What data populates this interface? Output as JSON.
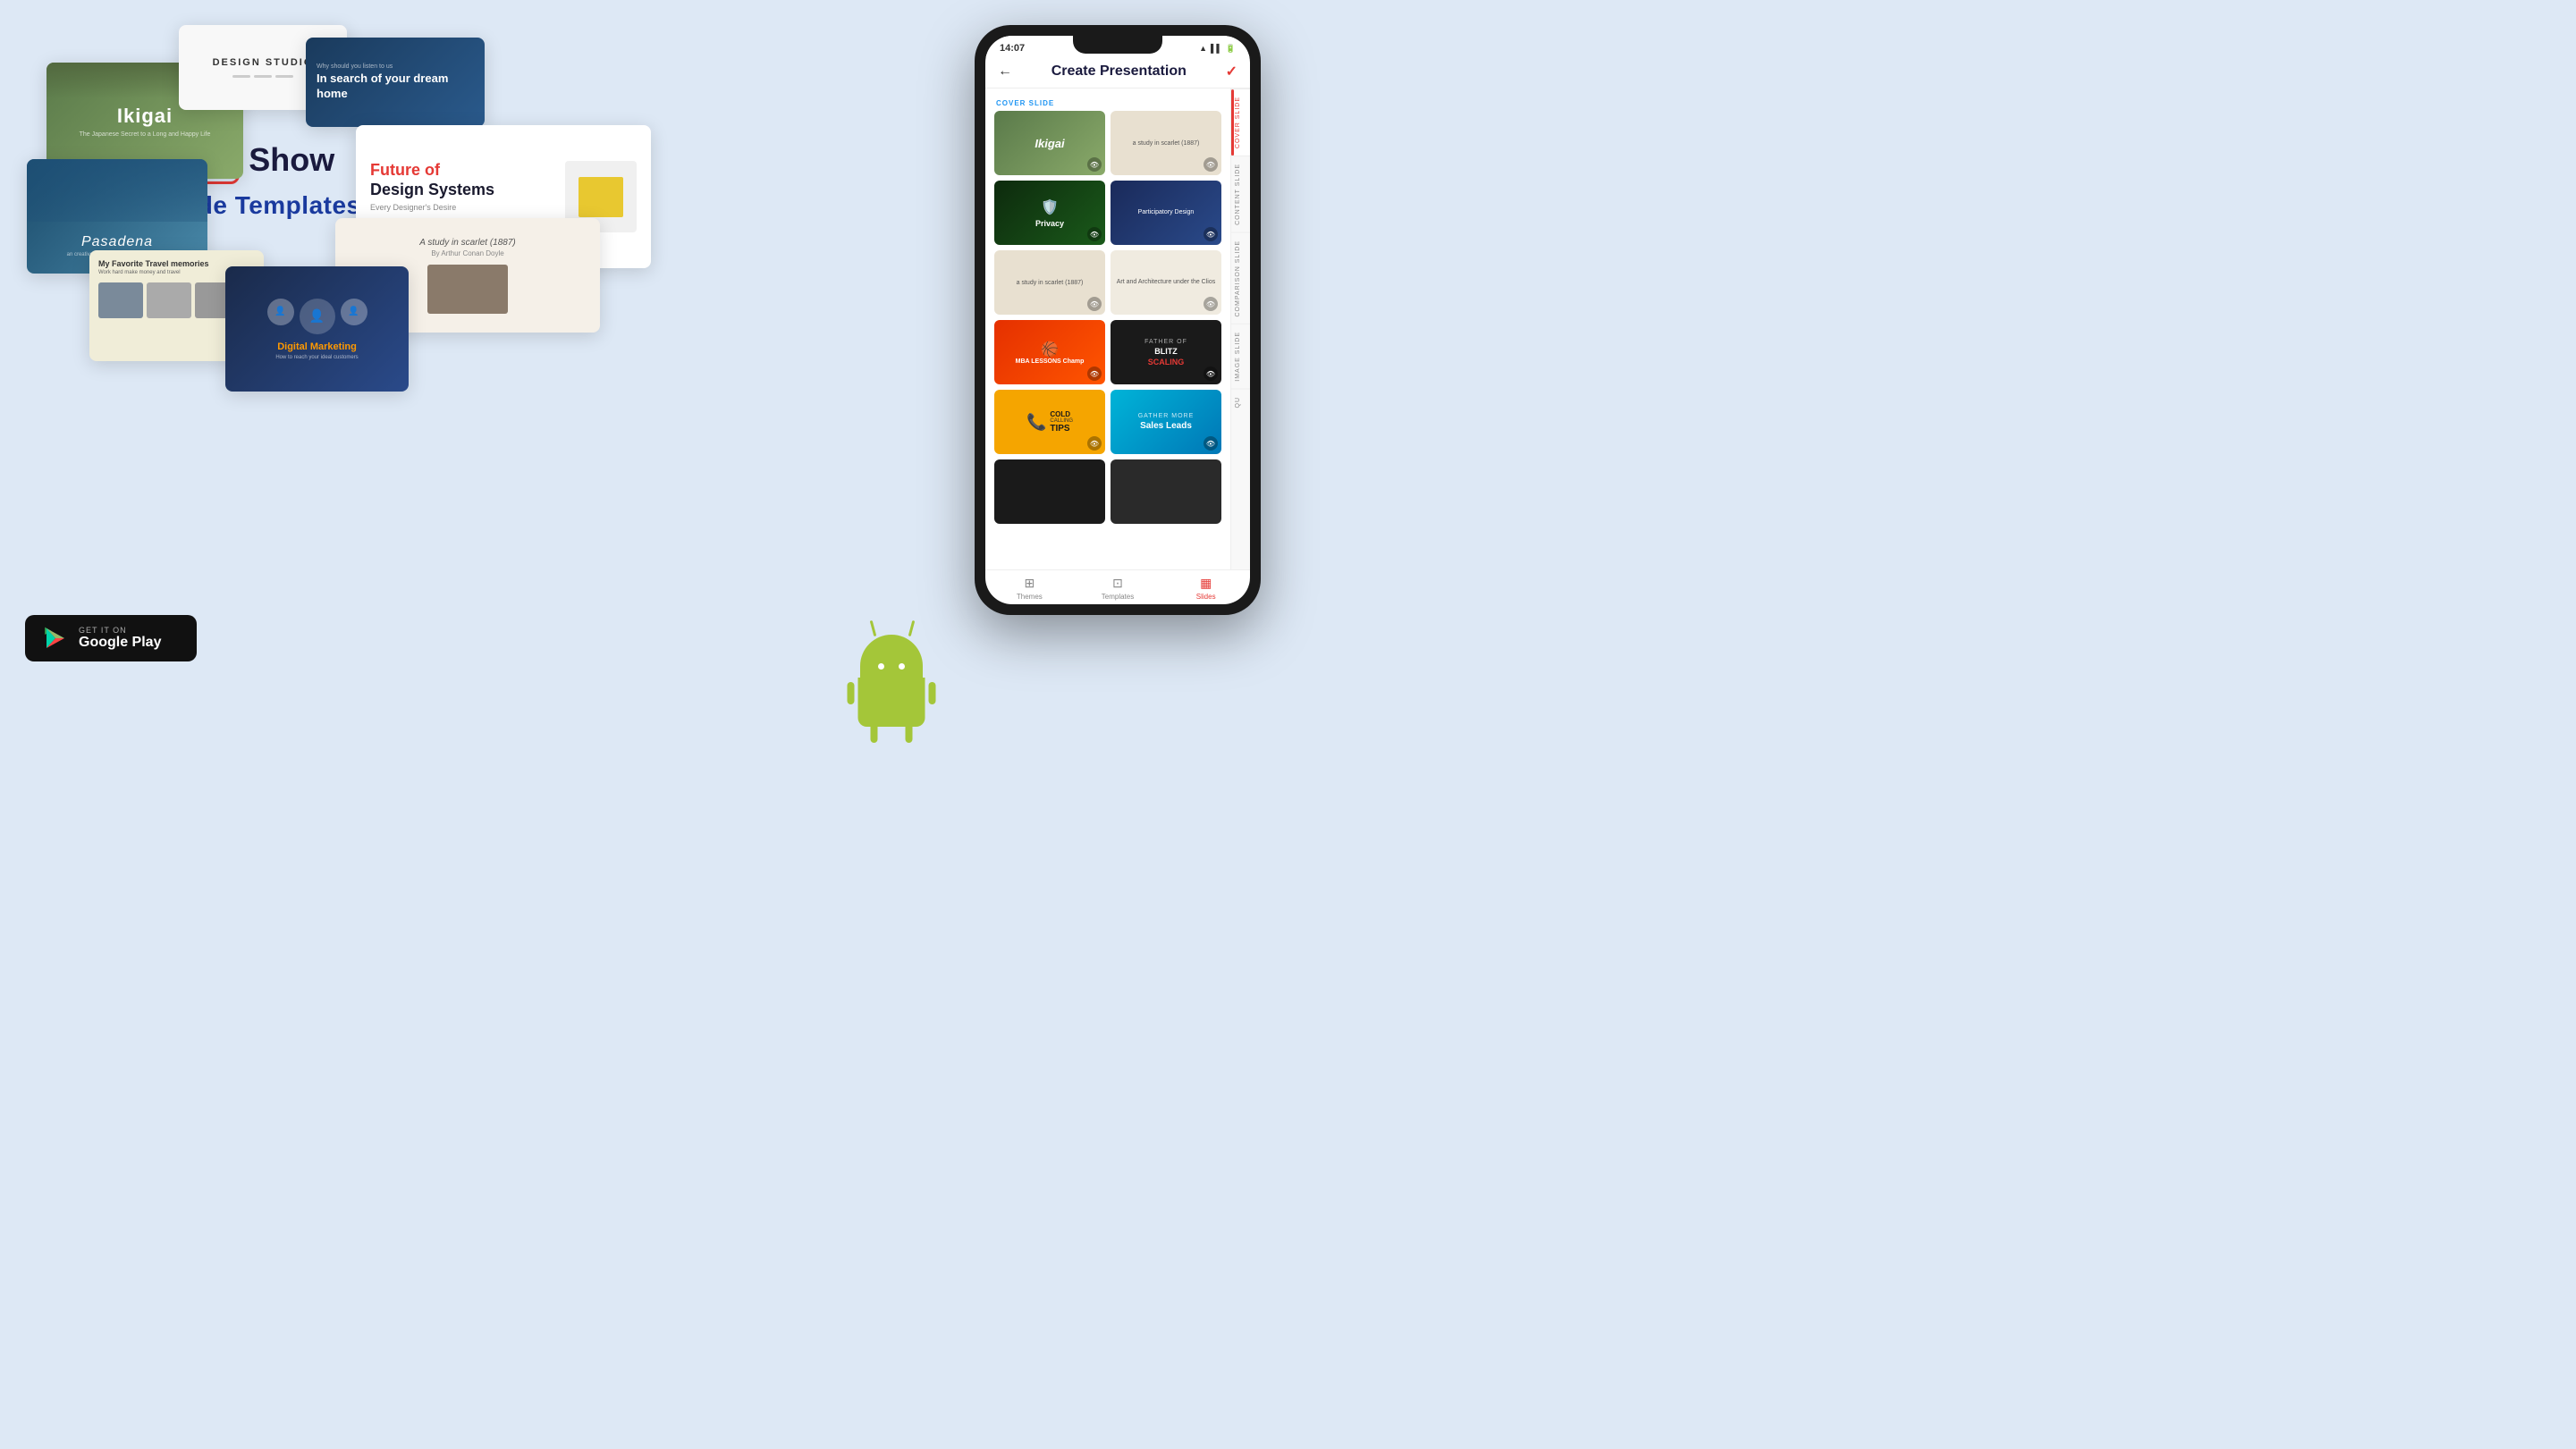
{
  "page": {
    "background_color": "#dde8f5",
    "title": "Show Slide Templates"
  },
  "brand": {
    "name": "Show",
    "subtitle": "Slide Templates",
    "icon_symbol": "▶"
  },
  "thumbnails": [
    {
      "id": "ikigai",
      "title": "Ikigai",
      "subtitle": "The Japanese Secret to a Long and Happy Life",
      "style": "botanical-green"
    },
    {
      "id": "design-studio",
      "title": "DESIGN STUDIO",
      "style": "minimal-white"
    },
    {
      "id": "dream-home",
      "label": "Why should you listen to us",
      "title": "In search of your dream home",
      "style": "dark-blue"
    },
    {
      "id": "pasadena",
      "title": "Pasadena",
      "subtitle": "an creative of places designers and others",
      "style": "mountain-blue"
    },
    {
      "id": "future-design",
      "title": "Future of Design Systems",
      "subtitle": "Every Designer's Desire",
      "style": "white-red"
    },
    {
      "id": "travel",
      "title": "My Favorite Travel memories",
      "subtitle": "Work hard make money and travel",
      "style": "beige"
    },
    {
      "id": "scarlet",
      "title": "A study in scarlet (1887)",
      "subtitle": "By Arthur Conan Doyle",
      "style": "off-white"
    },
    {
      "id": "digital-marketing",
      "title": "Digital Marketing",
      "subtitle": "How to reach your ideal customers",
      "style": "dark-navy"
    }
  ],
  "phone": {
    "time": "14:07",
    "app_title": "Create Presentation",
    "back_icon": "←",
    "check_icon": "✓",
    "section_label": "COVER SLIDE",
    "cover_slide_label": "COVER SLIDE",
    "slides": [
      {
        "id": "s1",
        "style": "card-ikigai",
        "text": "Ikigai"
      },
      {
        "id": "s2",
        "style": "card-study",
        "text": "A study in scarlet"
      },
      {
        "id": "s3",
        "style": "card-privacy",
        "text": "Privacy",
        "icon": "🛡️"
      },
      {
        "id": "s4",
        "style": "card-participatory",
        "text": "Participatory Design"
      },
      {
        "id": "s5",
        "style": "card-arch",
        "text": ""
      },
      {
        "id": "s6",
        "style": "card-arch2",
        "text": "Art and Architecture under the Clios"
      },
      {
        "id": "s7",
        "style": "card-mba",
        "text": "MBA LESSONS Champ"
      },
      {
        "id": "s8",
        "style": "card-blitz",
        "text": "BLITZ SCALING"
      },
      {
        "id": "s9",
        "style": "card-cold",
        "text": "COLD CALLING TIPS"
      },
      {
        "id": "s10",
        "style": "card-sales",
        "text": "Sales Leads"
      },
      {
        "id": "s11",
        "style": "card-dark1",
        "text": ""
      },
      {
        "id": "s12",
        "style": "card-dark2",
        "text": ""
      }
    ],
    "side_tabs": [
      {
        "id": "cover",
        "label": "COVER SLIDE",
        "active": true
      },
      {
        "id": "content",
        "label": "CONTENT SLIDE",
        "active": false
      },
      {
        "id": "comparison",
        "label": "COMPARISON SLIDE",
        "active": false
      },
      {
        "id": "image",
        "label": "IMAGE SLIDE",
        "active": false
      },
      {
        "id": "quote",
        "label": "QU",
        "active": false
      }
    ],
    "bottom_nav": [
      {
        "id": "themes",
        "label": "Themes",
        "icon": "⊞",
        "active": false
      },
      {
        "id": "templates",
        "label": "Templates",
        "icon": "⊡",
        "active": false
      },
      {
        "id": "slides",
        "label": "Slides",
        "icon": "▦",
        "active": true
      }
    ]
  },
  "play_store": {
    "top_text": "GET IT ON",
    "bottom_text": "Google Play"
  }
}
